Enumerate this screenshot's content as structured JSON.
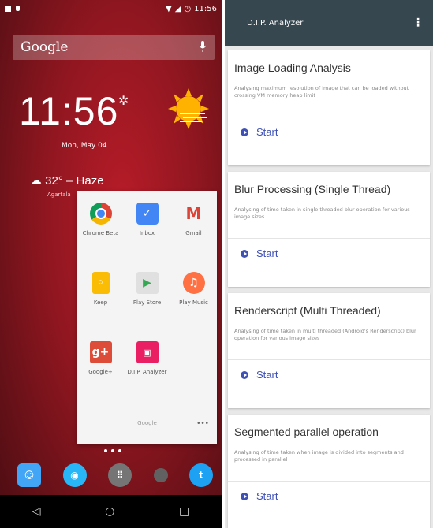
{
  "launcher": {
    "status_time": "11:56",
    "search_logo": "Google",
    "clock": "11:56",
    "date": "Mon, May 04",
    "weather": "32° – Haze",
    "weather_location": "Agartala",
    "folder": {
      "name": "Google",
      "apps": [
        {
          "label": "Chrome Beta",
          "icon": "chrome-beta-icon",
          "color": "#fbc02d",
          "glyph": "●"
        },
        {
          "label": "Inbox",
          "icon": "inbox-icon",
          "color": "#4285f4",
          "glyph": "✓"
        },
        {
          "label": "Gmail",
          "icon": "gmail-icon",
          "color": "#ffffff",
          "glyph": "M"
        },
        {
          "label": "Keep",
          "icon": "keep-icon",
          "color": "#fbbc05",
          "glyph": "💡"
        },
        {
          "label": "Play Store",
          "icon": "play-store-icon",
          "color": "#eeeeee",
          "glyph": "▶"
        },
        {
          "label": "Play Music",
          "icon": "play-music-icon",
          "color": "#ff7043",
          "glyph": "♫"
        },
        {
          "label": "Google+",
          "icon": "google-plus-icon",
          "color": "#dd4b39",
          "glyph": "g+"
        },
        {
          "label": "D.I.P. Analyzer",
          "icon": "dip-analyzer-icon",
          "color": "#e91e63",
          "glyph": "▣"
        }
      ]
    },
    "dock": [
      {
        "icon": "contacts-icon",
        "color": "#42a5f5",
        "glyph": "☺"
      },
      {
        "icon": "browser-icon",
        "color": "#29b6f6",
        "glyph": "◉"
      },
      {
        "icon": "app-drawer-icon",
        "color": "#757575",
        "glyph": "⋮⋮"
      },
      {
        "icon": "empty-slot-icon",
        "color": "#616161",
        "glyph": ""
      },
      {
        "icon": "twitter-icon",
        "color": "#1da1f2",
        "glyph": "t"
      }
    ]
  },
  "app": {
    "title": "D.I.P. Analyzer",
    "cards": [
      {
        "title": "Image Loading Analysis",
        "desc": "Analysing maximum resolution of image that can be loaded without crossing VM memory heap limit",
        "action": "Start"
      },
      {
        "title": "Blur Processing (Single Thread)",
        "desc": "Analysing of time taken in single threaded blur operation for various image sizes",
        "action": "Start"
      },
      {
        "title": "Renderscript (Multi Threaded)",
        "desc": "Analysing of time taken in multi threaded (Android's Renderscript) blur operation for various image sizes",
        "action": "Start"
      },
      {
        "title": "Segmented parallel operation",
        "desc": "Analysing of time taken when image is divided into segments and processed in parallel",
        "action": "Start"
      }
    ]
  }
}
